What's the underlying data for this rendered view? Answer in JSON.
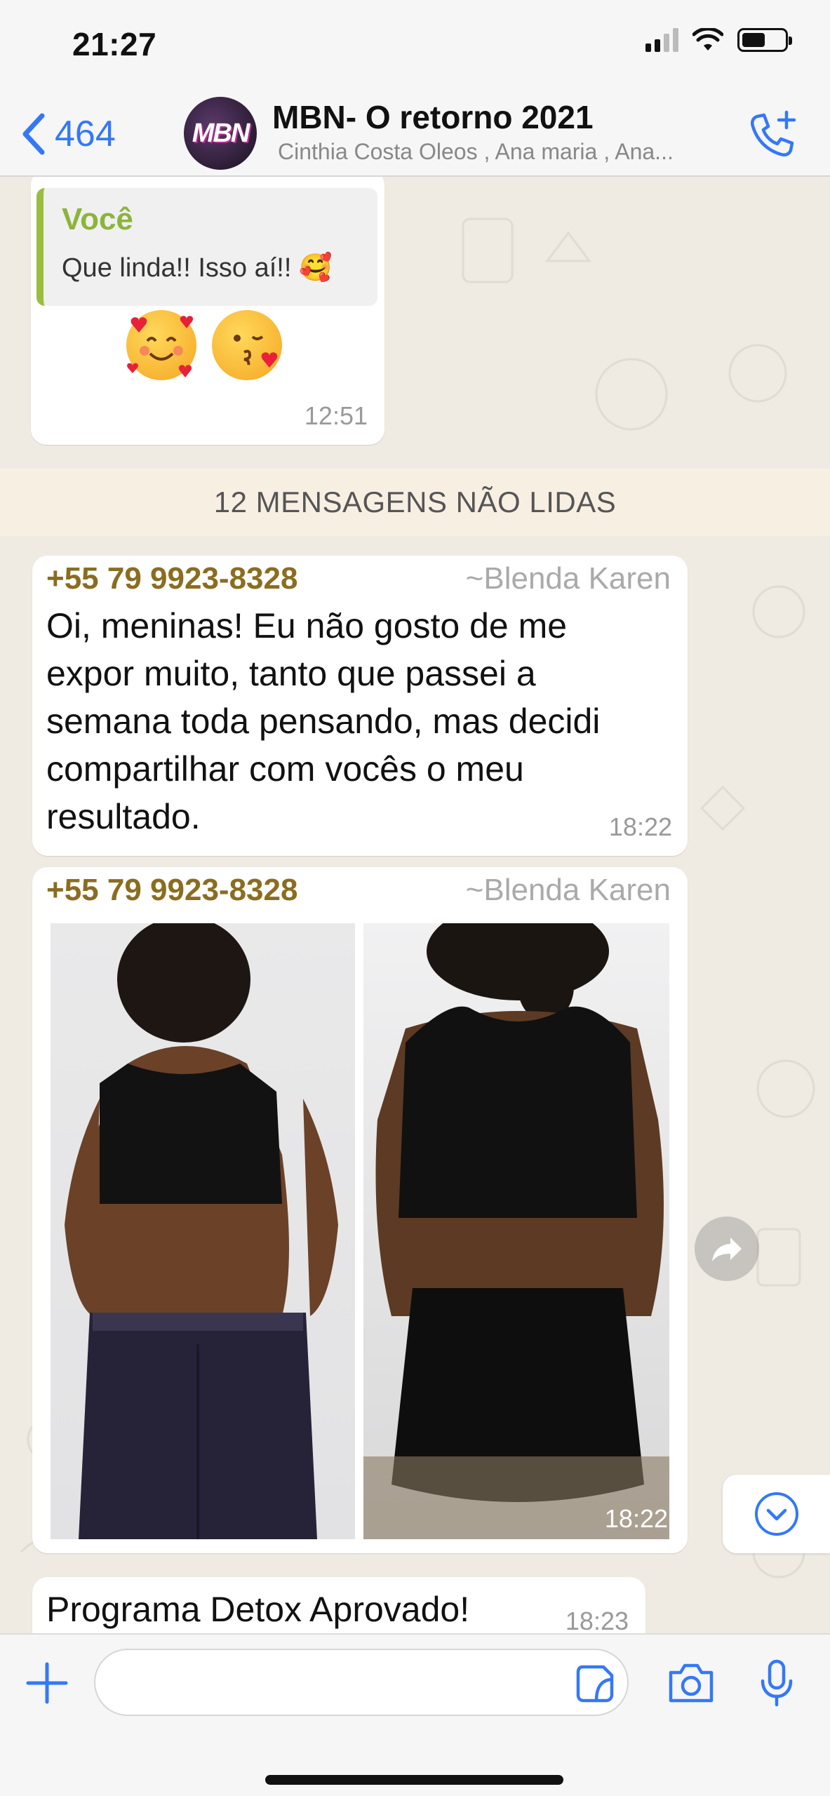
{
  "status_bar": {
    "time": "21:27",
    "battery_level": 0.55
  },
  "header": {
    "back_count": "464",
    "avatar_text": "MBN",
    "title": "MBN- O retorno 2021",
    "subtitle": "Cinthia Costa Oleos , Ana maria , Ana...",
    "accent_color": "#3478f6"
  },
  "messages": {
    "reply": {
      "quote_author": "Você",
      "quote_text": "Que linda!! Isso aí!! 🥰",
      "emojis": [
        "smiling-face-with-hearts",
        "face-blowing-kiss"
      ],
      "time": "12:51"
    },
    "unread_label": "12 MENSAGENS NÃO LIDAS",
    "text_message": {
      "phone": "+55 79 9923-8328",
      "name": "~Blenda Karen",
      "lines": [
        "Oi, meninas! Eu não gosto de me",
        "expor muito, tanto que passei a",
        "semana toda pensando, mas decidi",
        "compartilhar com vocês o meu",
        "resultado."
      ],
      "time": "18:22"
    },
    "image_message": {
      "phone": "+55 79 9923-8328",
      "name": "~Blenda Karen",
      "time": "18:22"
    },
    "last_message": {
      "text": "Programa Detox Aprovado!",
      "time": "18:23"
    }
  },
  "input": {
    "placeholder": ""
  }
}
